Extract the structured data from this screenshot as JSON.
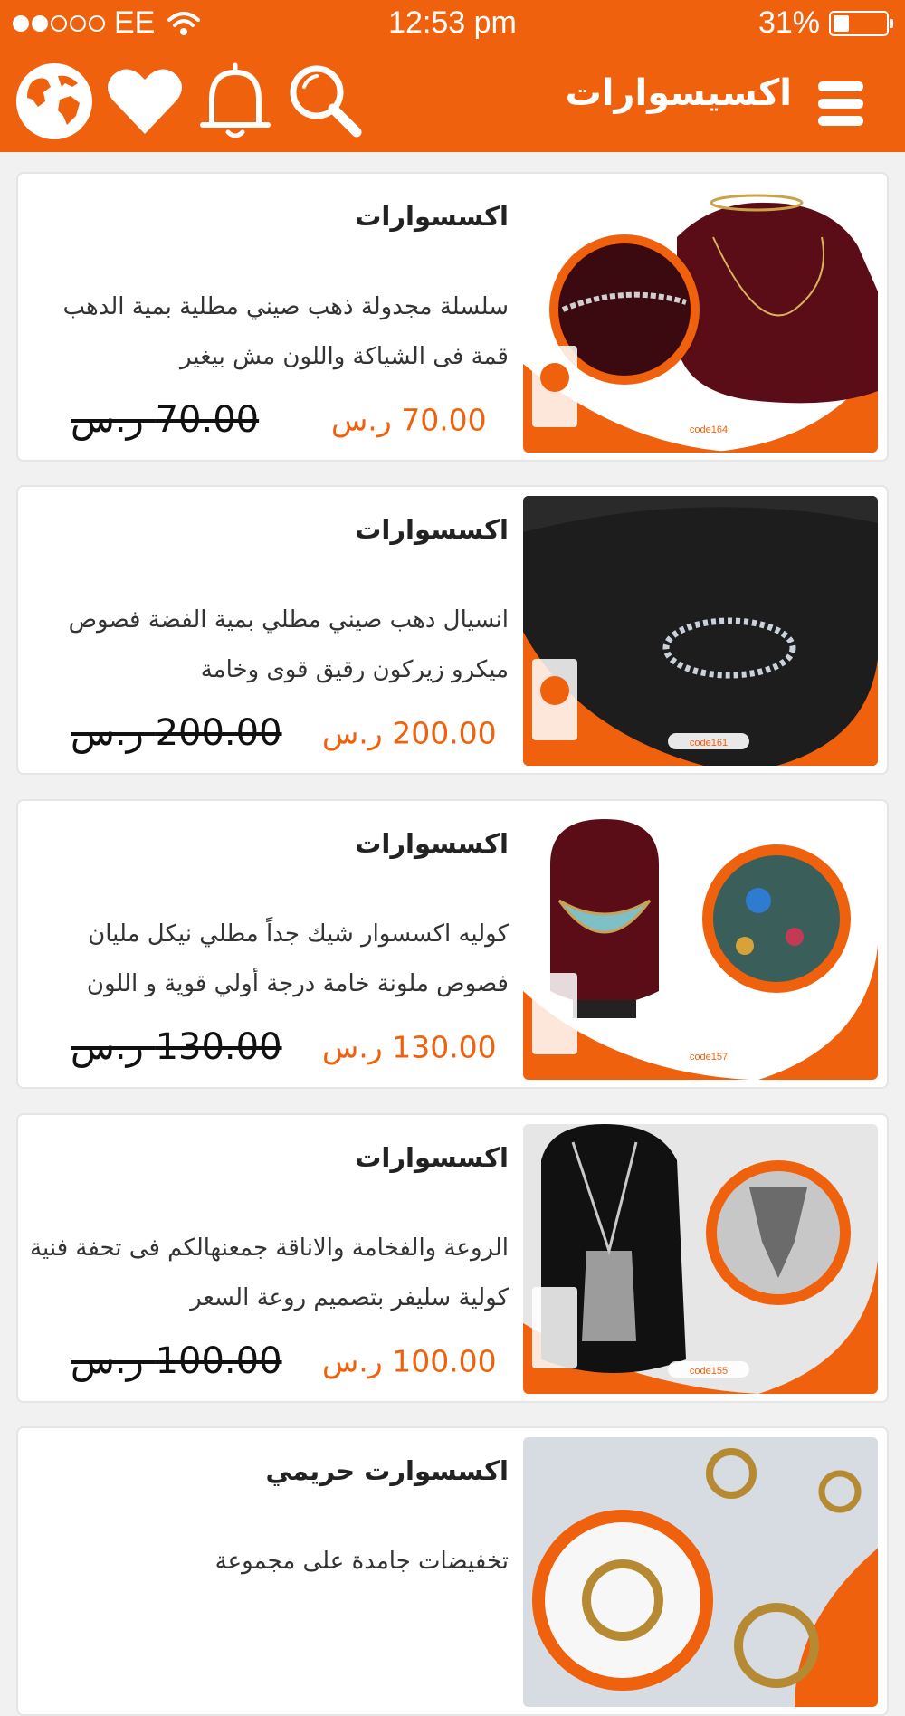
{
  "status_bar": {
    "carrier": "EE",
    "time": "12:53 pm",
    "battery": "31%",
    "battery_level": 0.31
  },
  "header": {
    "title": "اكسيسوارات",
    "icons": [
      "menu-icon",
      "search-icon",
      "bell-icon",
      "heart-icon",
      "globe-icon"
    ]
  },
  "colors": {
    "accent": "#f0610d",
    "background": "#f1f1f1"
  },
  "products": [
    {
      "category": "اكسسوارات",
      "description": "سلسلة مجدولة ذهب صيني مطلية بمية الدهب قمة فى الشياكة واللون مش بيغير",
      "price": "70.00 ر.س",
      "old_price": "70.00 ر.س",
      "image": "gold-chain-image",
      "image_code": "code164"
    },
    {
      "category": "اكسسوارات",
      "description": "انسيال دهب صيني مطلي بمية الفضة فصوص ميكرو زيركون رقيق قوى وخامة",
      "price": "200.00 ر.س",
      "old_price": "200.00 ر.س",
      "image": "silver-bracelet-image",
      "image_code": "code161"
    },
    {
      "category": "اكسسوارات",
      "description": "كوليه اكسسوار شيك جداً مطلي نيكل مليان فصوص ملونة خامة درجة أولي قوية و اللون",
      "price": "130.00 ر.س",
      "old_price": "130.00 ر.س",
      "image": "colored-necklace-image",
      "image_code": "code157"
    },
    {
      "category": "اكسسوارات",
      "description": "الروعة والفخامة والاناقة جمعنهالكم فى تحفة فنية كولية سليفر بتصميم روعة السعر",
      "price": "100.00 ر.س",
      "old_price": "100.00 ر.س",
      "image": "silver-fringe-necklace-image",
      "image_code": "code155"
    },
    {
      "category": "اكسسوارت حريمي",
      "description": "تخفيضات جامدة على مجموعة",
      "price": "",
      "old_price": "",
      "image": "gold-sun-set-image"
    }
  ]
}
